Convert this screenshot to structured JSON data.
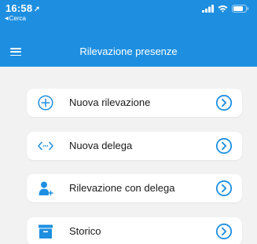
{
  "status_bar": {
    "time": "16:58",
    "location_arrow": "➚",
    "back_app": "Cerca",
    "back_triangle": "◀",
    "icons": [
      "signal-icon",
      "wifi-icon",
      "battery-icon"
    ]
  },
  "nav": {
    "title": "Rilevazione presenze",
    "menu_icon": "hamburger-menu-icon"
  },
  "colors": {
    "accent": "#1e8fe0",
    "background": "#f2f2f2",
    "card": "#ffffff",
    "text": "#1a1a1a"
  },
  "menu": [
    {
      "label": "Nuova rilevazione",
      "icon": "plus-circle-icon",
      "action_icon": "chevron-circle-right-icon"
    },
    {
      "label": "Nuova delega",
      "icon": "code-arrows-icon",
      "action_icon": "chevron-circle-right-icon"
    },
    {
      "label": "Rilevazione con delega",
      "icon": "user-plus-icon",
      "action_icon": "chevron-circle-right-icon"
    },
    {
      "label": "Storico",
      "icon": "archive-box-icon",
      "action_icon": "chevron-circle-right-icon"
    }
  ]
}
